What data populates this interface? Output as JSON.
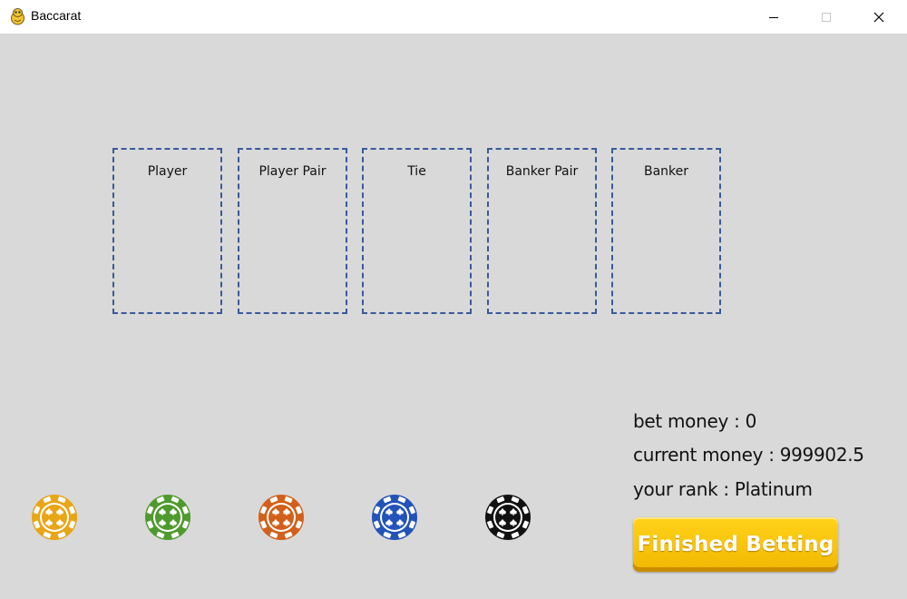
{
  "window": {
    "title": "Baccarat"
  },
  "bet_areas": [
    {
      "label": "Player"
    },
    {
      "label": "Player Pair"
    },
    {
      "label": "Tie"
    },
    {
      "label": "Banker Pair"
    },
    {
      "label": "Banker"
    }
  ],
  "info": {
    "bet_money": "bet money : 0",
    "current_money": "current money : 999902.5",
    "rank": "your rank : Platinum"
  },
  "finish_button": {
    "label": "Finished Betting"
  },
  "chips": [
    {
      "name": "gold-chip",
      "color": "#e8a516"
    },
    {
      "name": "green-chip",
      "color": "#4f9a2e"
    },
    {
      "name": "orange-chip",
      "color": "#d2601a"
    },
    {
      "name": "blue-chip",
      "color": "#2253b8"
    },
    {
      "name": "black-chip",
      "color": "#111111"
    }
  ],
  "colors": {
    "background": "#d9d9d9",
    "area_border": "#3a5a9a",
    "button": "#f5c000"
  }
}
